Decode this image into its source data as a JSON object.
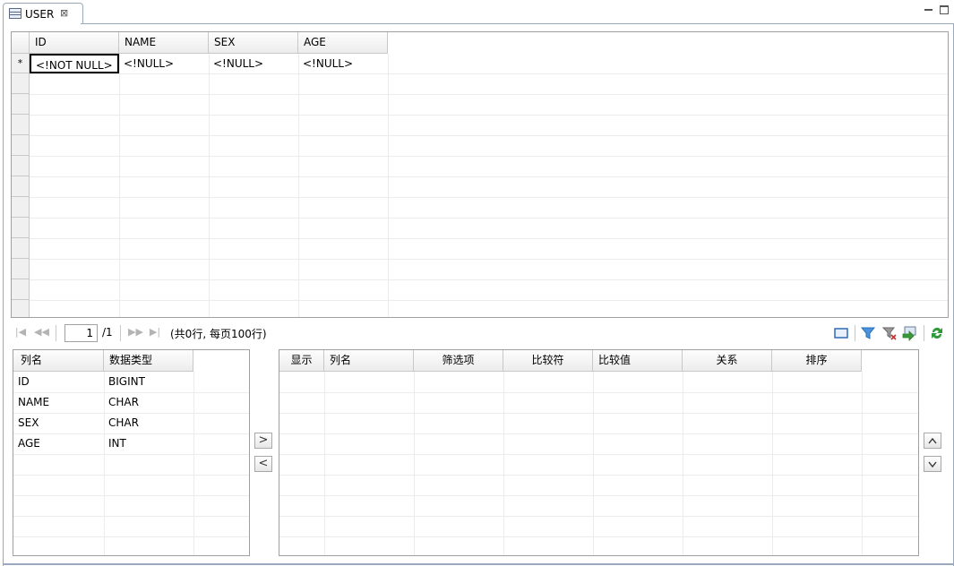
{
  "tab": {
    "title": "USER",
    "close": "⊠"
  },
  "grid": {
    "columns": [
      "ID",
      "NAME",
      "SEX",
      "AGE"
    ],
    "new_row_marker": "*",
    "new_row": [
      "<!NOT NULL>",
      "<!NULL>",
      "<!NULL>",
      "<!NULL>"
    ]
  },
  "pager": {
    "first_icon": "first-page-icon",
    "prev_icon": "prev-page-icon",
    "page": "1",
    "total_pages": "/1",
    "next_icon": "next-page-icon",
    "last_icon": "last-page-icon",
    "row_info": "(共0行, 每页100行)"
  },
  "column_panel": {
    "headers": [
      "列名",
      "数据类型"
    ],
    "rows": [
      {
        "name": "ID",
        "type": "BIGINT"
      },
      {
        "name": "NAME",
        "type": "CHAR"
      },
      {
        "name": "SEX",
        "type": "CHAR"
      },
      {
        "name": "AGE",
        "type": "INT"
      }
    ]
  },
  "move_buttons": {
    "add": ">",
    "remove": "<",
    "up": "^",
    "down": "v"
  },
  "filter_panel": {
    "headers": [
      "显示",
      "列名",
      "筛选项",
      "比较符",
      "比较值",
      "关系",
      "排序"
    ]
  },
  "colors": {
    "accent_border": "#9aa9bd",
    "grid_line": "#ececec",
    "disabled_icon": "#b4b4b4",
    "refresh_green": "#2e9a3a",
    "filter_blue": "#2f7fd2"
  }
}
